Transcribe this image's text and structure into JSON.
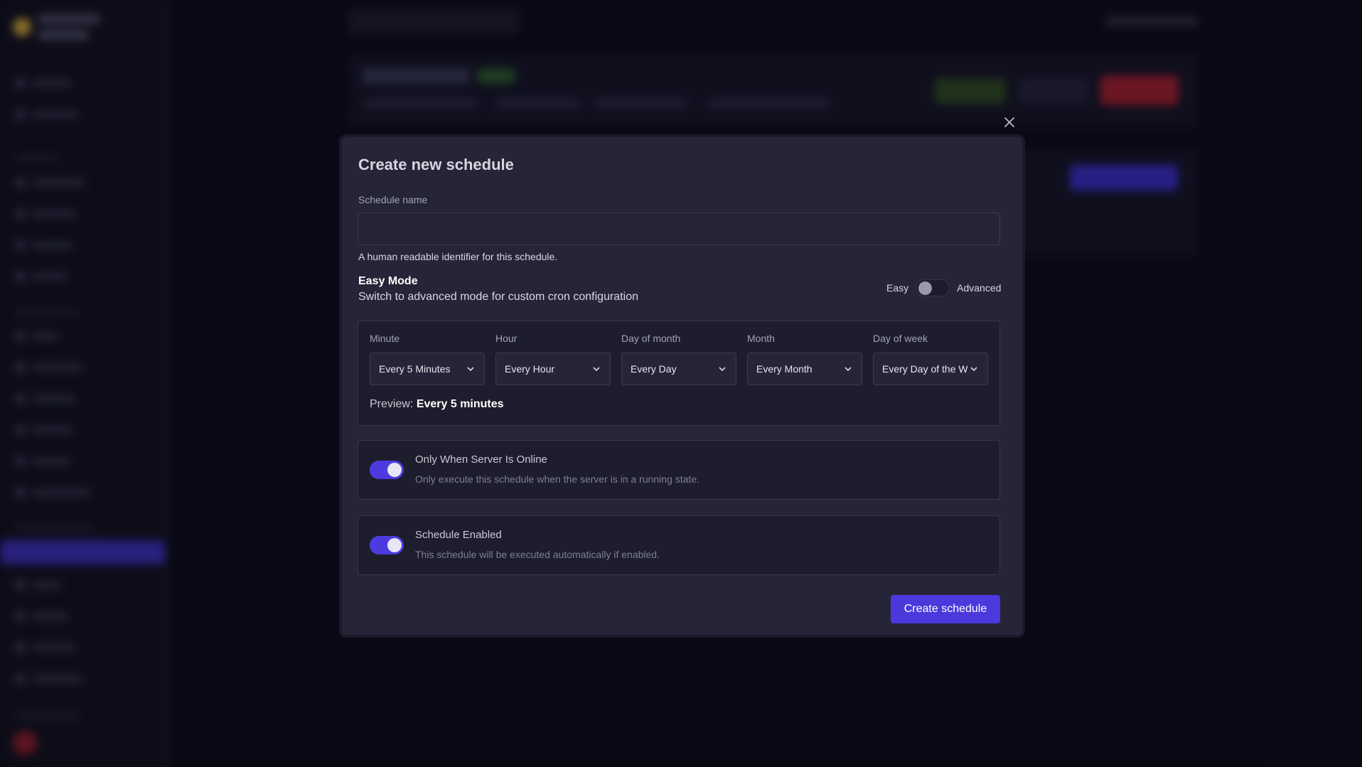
{
  "background": {
    "brand": "",
    "nav": []
  },
  "modal": {
    "title": "Create new schedule",
    "name_field": {
      "label": "Schedule name",
      "value": "",
      "placeholder": "",
      "hint": "A human readable identifier for this schedule."
    },
    "mode": {
      "title": "Easy Mode",
      "description": "Switch to advanced mode for custom cron configuration",
      "left_label": "Easy",
      "right_label": "Advanced",
      "advanced_enabled": false
    },
    "cron": {
      "fields": [
        {
          "label": "Minute",
          "value": "Every 5 Minutes"
        },
        {
          "label": "Hour",
          "value": "Every Hour"
        },
        {
          "label": "Day of month",
          "value": "Every Day"
        },
        {
          "label": "Month",
          "value": "Every Month"
        },
        {
          "label": "Day of week",
          "value": "Every Day of the Week"
        }
      ],
      "preview_label": "Preview:",
      "preview_value": "Every 5 minutes"
    },
    "options": [
      {
        "title": "Only When Server Is Online",
        "description": "Only execute this schedule when the server is in a running state.",
        "enabled": true
      },
      {
        "title": "Schedule Enabled",
        "description": "This schedule will be executed automatically if enabled.",
        "enabled": true
      }
    ],
    "submit_label": "Create schedule"
  },
  "colors": {
    "accent": "#4b39dc",
    "modal_bg": "#262538",
    "page_bg": "#0c0b1a"
  }
}
